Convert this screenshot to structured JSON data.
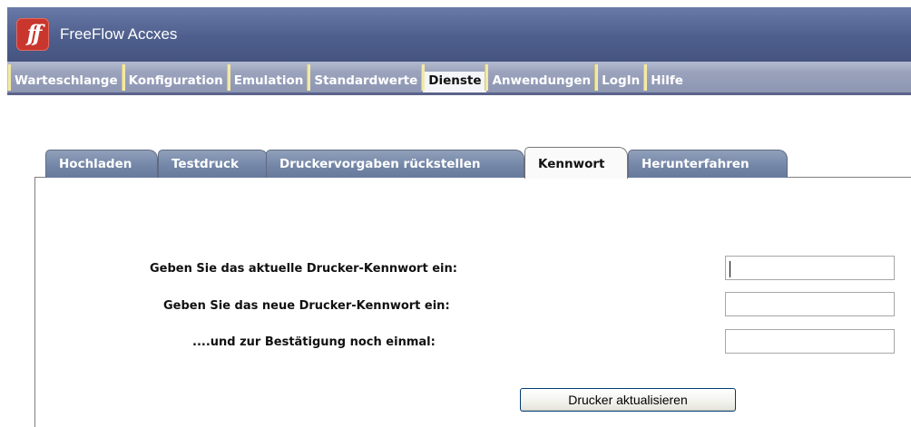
{
  "app": {
    "logo_text": "ff",
    "title": "FreeFlow Accxes"
  },
  "topnav": {
    "items": [
      "Warteschlange",
      "Konfiguration",
      "Emulation",
      "Standardwerte",
      "Dienste",
      "Anwendungen",
      "LogIn",
      "Hilfe"
    ],
    "active": "Dienste"
  },
  "subtabs": {
    "items": [
      "Hochladen",
      "Testdruck",
      "Druckervorgaben rückstellen",
      "Kennwort",
      "Herunterfahren"
    ],
    "active": "Kennwort"
  },
  "form": {
    "current_label": "Geben Sie das aktuelle Drucker-Kennwort ein:",
    "new_label": "Geben Sie das neue Drucker-Kennwort ein:",
    "confirm_label": "....und zur Bestätigung noch einmal:",
    "current_value": "",
    "new_value": "",
    "confirm_value": "",
    "submit_label": "Drucker aktualisieren"
  },
  "colors": {
    "title_bar": "#4f5f8d",
    "nav_bar": "#9aa2bc",
    "tab_inactive": "#7285a6",
    "separator": "#f2e9a8"
  }
}
